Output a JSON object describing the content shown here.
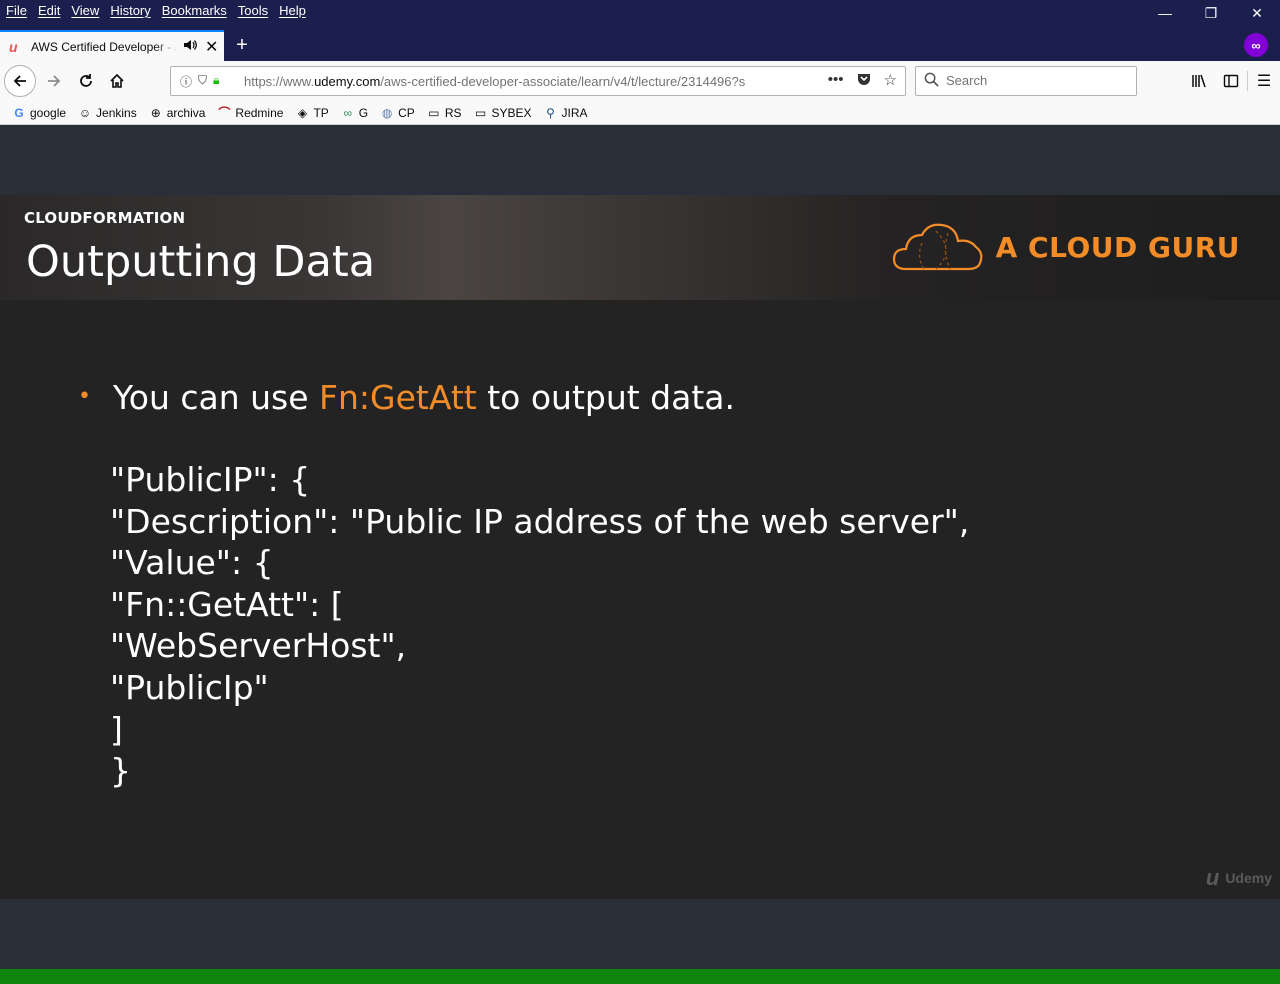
{
  "menubar": {
    "items": [
      "File",
      "Edit",
      "View",
      "History",
      "Bookmarks",
      "Tools",
      "Help"
    ]
  },
  "window_controls": {
    "minimize": "—",
    "restore": "❐",
    "close": "✕"
  },
  "tab": {
    "title": "AWS Certified Developer - A",
    "favicon": "udemy-u",
    "audio_icon": "speaker-icon",
    "close": "✕"
  },
  "newtab_label": "+",
  "navbar": {
    "url_prefix": "https://www.",
    "url_domain": "udemy.com",
    "url_path": "/aws-certified-developer-associate/learn/v4/t/lecture/2314496?s",
    "page_actions": "•••",
    "search_placeholder": "Search"
  },
  "bookmarks": [
    {
      "icon": "G",
      "label": "google"
    },
    {
      "icon": "☺",
      "label": "Jenkins"
    },
    {
      "icon": "⊕",
      "label": "archiva"
    },
    {
      "icon": "⌒",
      "label": "Redmine"
    },
    {
      "icon": "◈",
      "label": "TP"
    },
    {
      "icon": "∞",
      "label": "G"
    },
    {
      "icon": "◍",
      "label": "CP"
    },
    {
      "icon": "▭",
      "label": "RS"
    },
    {
      "icon": "▭",
      "label": "SYBEX"
    },
    {
      "icon": "⚲",
      "label": "JIRA"
    }
  ],
  "slide": {
    "section": "CLOUDFORMATION",
    "title": "Outputting Data",
    "brand": "A CLOUD GURU",
    "bullet_before": "You can use ",
    "bullet_highlight": "Fn:GetAtt",
    "bullet_after": " to output data.",
    "code_lines": [
      "\"PublicIP\": {",
      "\"Description\": \"Public IP address of the web server\",",
      "\"Value\": {",
      "\"Fn::GetAtt\": [",
      "\"WebServerHost\",",
      "\"PublicIp\"",
      "]",
      "}"
    ],
    "watermark": "Udemy"
  },
  "colors": {
    "accent_orange": "#f28c28",
    "progress_green": "#10850c",
    "chrome_dark": "#1b1f4d"
  },
  "progress": {
    "fraction": 1.0
  }
}
